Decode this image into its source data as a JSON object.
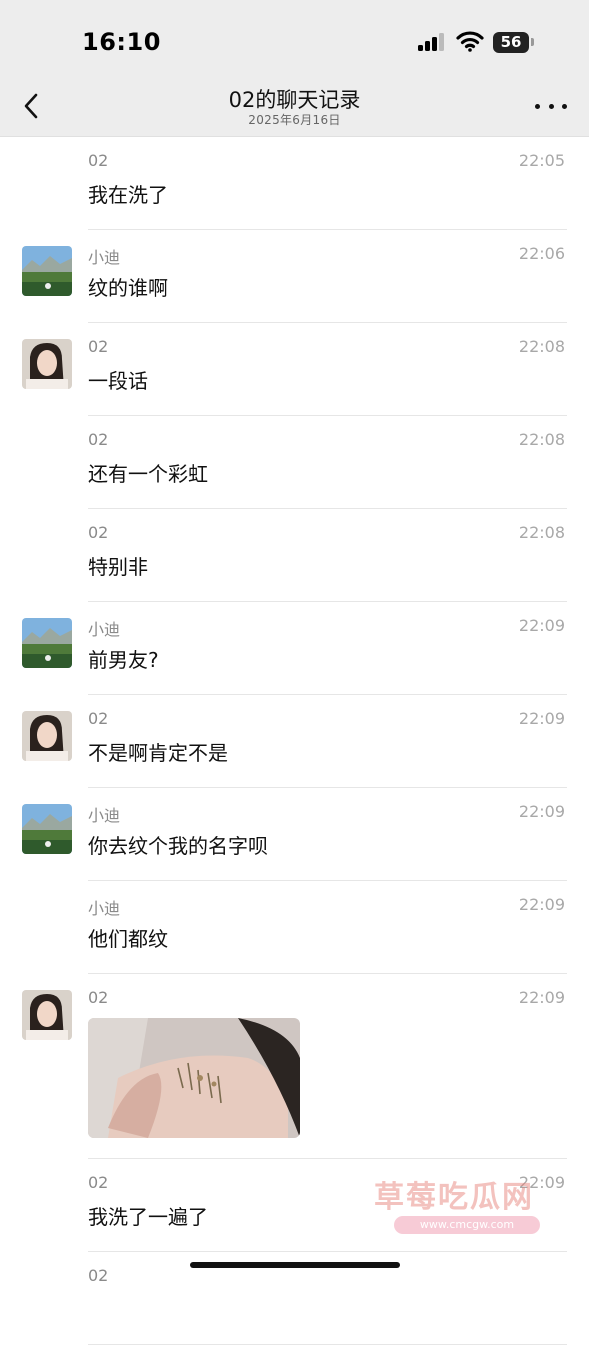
{
  "status_bar": {
    "time": "16:10",
    "battery": "56"
  },
  "nav": {
    "title": "02的聊天记录",
    "subtitle": "2025年6月16日"
  },
  "messages": [
    {
      "sender": "02",
      "time": "22:05",
      "text": "我在洗了"
    },
    {
      "sender": "小迪",
      "time": "22:06",
      "text": "纹的谁啊"
    },
    {
      "sender": "02",
      "time": "22:08",
      "text": "一段话"
    },
    {
      "sender": "02",
      "time": "22:08",
      "text": "还有一个彩虹"
    },
    {
      "sender": "02",
      "time": "22:08",
      "text": "特别非"
    },
    {
      "sender": "小迪",
      "time": "22:09",
      "text": "前男友?"
    },
    {
      "sender": "02",
      "time": "22:09",
      "text": "不是啊肯定不是"
    },
    {
      "sender": "小迪",
      "time": "22:09",
      "text": "你去纹个我的名字呗"
    },
    {
      "sender": "小迪",
      "time": "22:09",
      "text": "他们都纹"
    },
    {
      "sender": "02",
      "time": "22:09",
      "text": ""
    },
    {
      "sender": "02",
      "time": "22:09",
      "text": "我洗了一遍了"
    },
    {
      "sender": "02",
      "time": "",
      "text": ""
    }
  ],
  "watermark": {
    "text": "草莓吃瓜网",
    "url": "www.cmcgw.com"
  }
}
